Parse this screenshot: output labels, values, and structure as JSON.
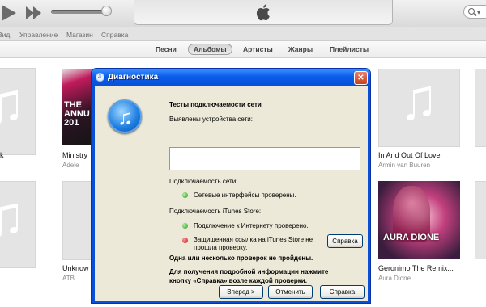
{
  "menu": [
    "Вид",
    "Управление",
    "Магазин",
    "Справка"
  ],
  "tabs": [
    {
      "label": "Песни",
      "active": false
    },
    {
      "label": "Альбомы",
      "active": true
    },
    {
      "label": "Артисты",
      "active": false
    },
    {
      "label": "Жанры",
      "active": false
    },
    {
      "label": "Плейлисты",
      "active": false
    }
  ],
  "albums": [
    {
      "title": "k",
      "artist": ""
    },
    {
      "title": "Ministry",
      "artist": "Adele"
    },
    {
      "title": "In And Out Of Love",
      "artist": "Armin van Buuren"
    },
    {
      "title": "Unknow",
      "artist": "ATB"
    },
    {
      "title": "Geronimo  The Remix...",
      "artist": "Aura Dione"
    }
  ],
  "covers": {
    "ministry_text": "THE ANNU 201",
    "aura_text": "AURA DIONE"
  },
  "dialog": {
    "title": "Диагностика",
    "close": "✕",
    "heading": "Тесты подключаемости сети",
    "devices_label": "Выявлены устройства сети:",
    "devices_value": "",
    "connectivity_label": "Подключаемость сети:",
    "check1": {
      "text": "Сетевые интерфейсы проверены.",
      "status": "passed"
    },
    "store_label": "Подключаемость iTunes Store:",
    "check2": {
      "text": "Подключение к Интернету проверено.",
      "status": "passed"
    },
    "check3": {
      "text_line1": "Защищенная ссылка на iTunes Store не",
      "text_line2": "прошла проверку.",
      "status": "failed"
    },
    "check3_help": "Справка",
    "fail_msg": "Одна или несколько проверок не пройдены.",
    "info_line1": "Для получения подробной информации нажмите",
    "info_line2": "кнопку «Справка» возле каждой проверки.",
    "next": "Вперед >",
    "cancel": "Отменить",
    "help": "Справка"
  },
  "colors": {
    "passed": "#2e9a1f",
    "failed": "#c80f0f",
    "title_bar": "#0a5cea"
  }
}
